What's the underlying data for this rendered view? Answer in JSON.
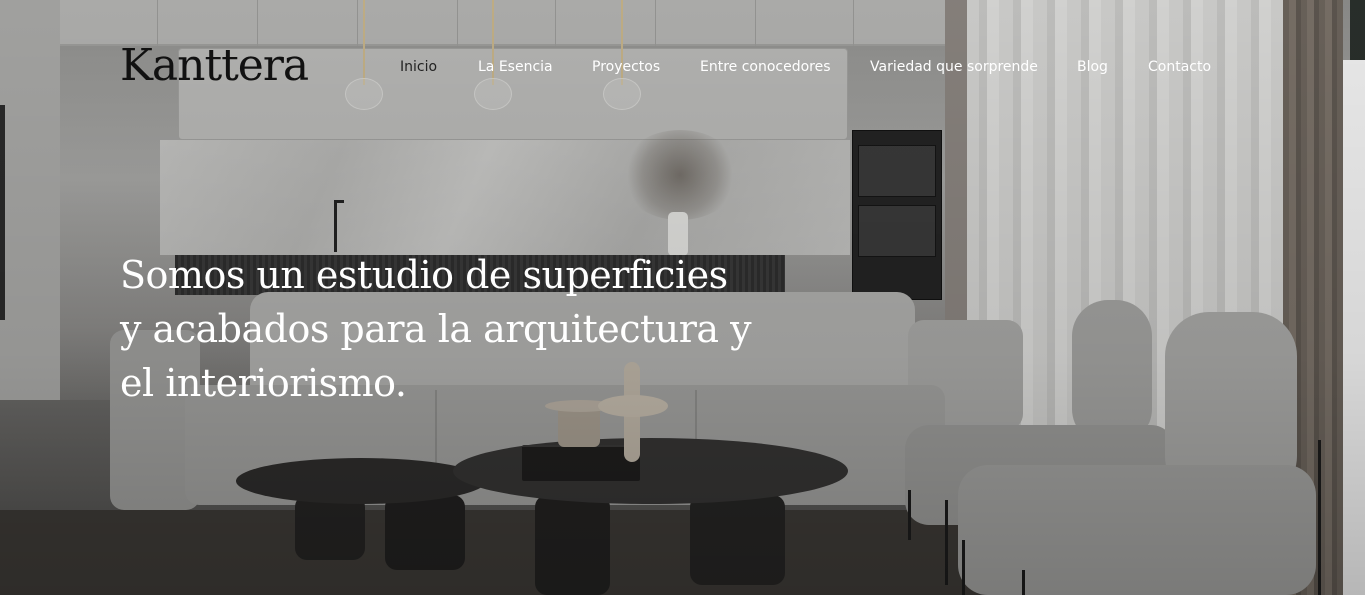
{
  "brand": {
    "logo_text": "Kanttera"
  },
  "nav": {
    "items": [
      {
        "label": "Inicio",
        "active": true
      },
      {
        "label": "La Esencia",
        "active": false
      },
      {
        "label": "Proyectos",
        "active": false
      },
      {
        "label": "Entre conocedores",
        "active": false
      },
      {
        "label": "Variedad que sorprende",
        "active": false
      },
      {
        "label": "Blog",
        "active": false
      },
      {
        "label": "Contacto",
        "active": false
      }
    ]
  },
  "hero": {
    "headline": "Somos un estudio de superficies y acabados para la arquitectura y el interiorismo.",
    "background_image": "living-room-interior"
  },
  "colors": {
    "headline_text": "#ffffff",
    "nav_text": "#ffffff",
    "nav_active_text": "#222222",
    "logo_text": "#111111"
  }
}
